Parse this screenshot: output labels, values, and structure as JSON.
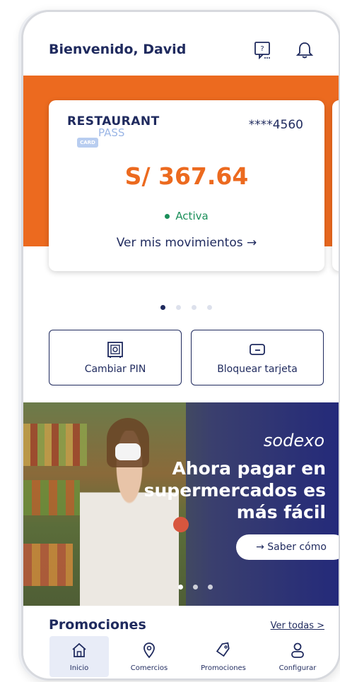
{
  "header": {
    "welcome": "Bienvenido, David",
    "icons": [
      "help-chat-icon",
      "bell-icon"
    ]
  },
  "card": {
    "brand_top": "RESTAURANT",
    "brand_bottom": "PASS",
    "brand_badge": "CARD",
    "number": "****4560",
    "balance": "S/ 367.64",
    "status": "Activa",
    "movements_link": "Ver mis movimientos →"
  },
  "carousel": {
    "total": 4,
    "active_index": 0
  },
  "actions": [
    {
      "label": "Cambiar PIN",
      "icon": "safe-icon"
    },
    {
      "label": "Bloquear tarjeta",
      "icon": "card-icon"
    }
  ],
  "banner": {
    "brand": "sodexo",
    "headline_lines": [
      "Ahora pagar en",
      "supermercados es",
      "más fácil"
    ],
    "cta": "→  Saber cómo",
    "dots_total": 3,
    "active_dot": 0
  },
  "promotions": {
    "title": "Promociones",
    "see_all": "Ver todas >"
  },
  "nav": [
    {
      "label": "Inicio",
      "icon": "home-icon",
      "active": true
    },
    {
      "label": "Comercios",
      "icon": "location-pin-icon",
      "active": false
    },
    {
      "label": "Promociones",
      "icon": "tag-icon",
      "active": false
    },
    {
      "label": "Configurar",
      "icon": "user-icon",
      "active": false
    }
  ],
  "colors": {
    "brand_orange": "#ec6a1f",
    "navy": "#1f2a5e",
    "active_green": "#1b8f5a"
  }
}
